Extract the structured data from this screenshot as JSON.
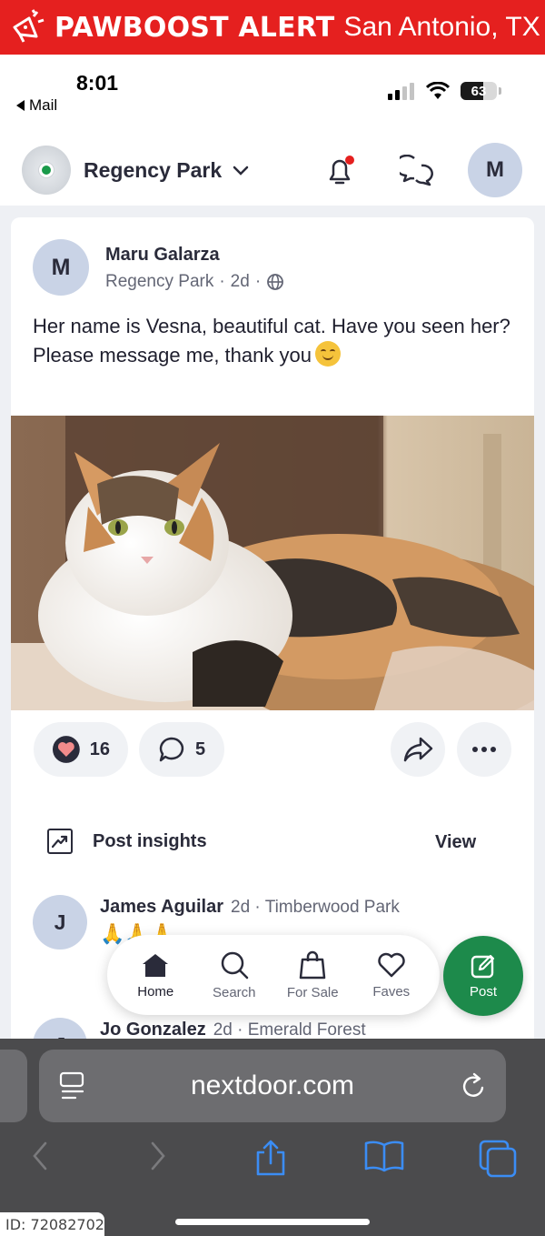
{
  "alert": {
    "title": "PAWBOOST ALERT",
    "location": "San Antonio, TX",
    "icon": "megaphone-paw-icon"
  },
  "status_bar": {
    "time": "8:01",
    "back_app": "Mail",
    "battery": "63"
  },
  "header": {
    "neighborhood": "Regency Park",
    "user_initial": "M"
  },
  "post": {
    "author_initial": "M",
    "author": "Maru Galarza",
    "neighborhood": "Regency Park",
    "age": "2d",
    "text_line1": "Her name is Vesna, beautiful cat. Have you seen her?",
    "text_line2": "Please message me, thank you",
    "photo_alt": "Calico cat lying down",
    "reactions": "16",
    "comments": "5"
  },
  "insights": {
    "label": "Post insights",
    "action": "View"
  },
  "comments": [
    {
      "initial": "J",
      "name": "James Aguilar",
      "age": "2d",
      "neighborhood": "Timberwood Park",
      "text": "🙏🙏🙏"
    },
    {
      "initial": "J",
      "name": "Jo Gonzalez",
      "age": "2d",
      "neighborhood": "Emerald Forest"
    }
  ],
  "nav": {
    "home": "Home",
    "search": "Search",
    "for_sale": "For Sale",
    "faves": "Faves",
    "post": "Post"
  },
  "browser": {
    "url": "nextdoor.com"
  },
  "footer": {
    "id": "ID: 72082702"
  },
  "colors": {
    "alert_red": "#e5201f",
    "brand_green": "#1d8a4b",
    "notification_dot": "#e5201f"
  }
}
